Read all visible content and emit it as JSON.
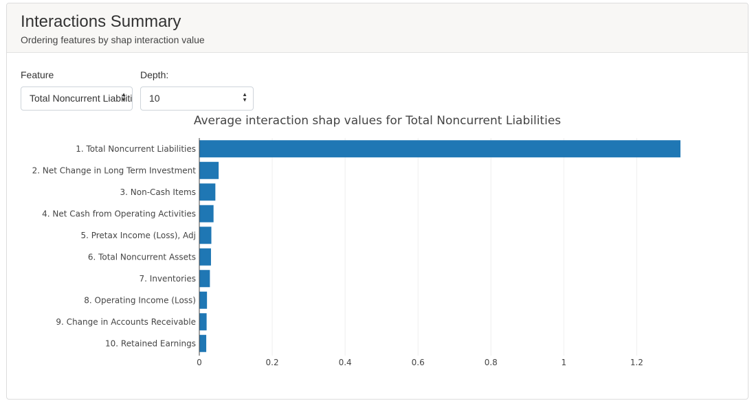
{
  "header": {
    "title": "Interactions Summary",
    "subtitle": "Ordering features by shap interaction value"
  },
  "controls": {
    "feature_label": "Feature",
    "feature_value": "Total Noncurrent Liabilities",
    "depth_label": "Depth:",
    "depth_value": "10"
  },
  "icons": {
    "select_arrow": "sort-arrows-icon"
  },
  "colors": {
    "bar": "#1f77b4",
    "grid": "#eeeeee"
  },
  "chart_data": {
    "type": "bar",
    "orientation": "horizontal",
    "title": "Average interaction shap values for Total Noncurrent Liabilities",
    "categories": [
      "1. Total Noncurrent Liabilities",
      "2. Net Change in Long Term Investment",
      "3. Non-Cash Items",
      "4. Net Cash from Operating Activities",
      "5. Pretax Income (Loss), Adj",
      "6. Total Noncurrent Assets",
      "7. Inventories",
      "8. Operating Income (Loss)",
      "9. Change in Accounts Receivable",
      "10. Retained Earnings"
    ],
    "values": [
      1.32,
      0.053,
      0.044,
      0.039,
      0.033,
      0.032,
      0.029,
      0.021,
      0.02,
      0.019
    ],
    "xlim": [
      0,
      1.32
    ],
    "xticks": [
      "0",
      "0.2",
      "0.4",
      "0.6",
      "0.8",
      "1",
      "1.2"
    ],
    "xtick_values": [
      0,
      0.2,
      0.4,
      0.6,
      0.8,
      1.0,
      1.2
    ],
    "grid": true,
    "xlabel": "",
    "ylabel": ""
  }
}
